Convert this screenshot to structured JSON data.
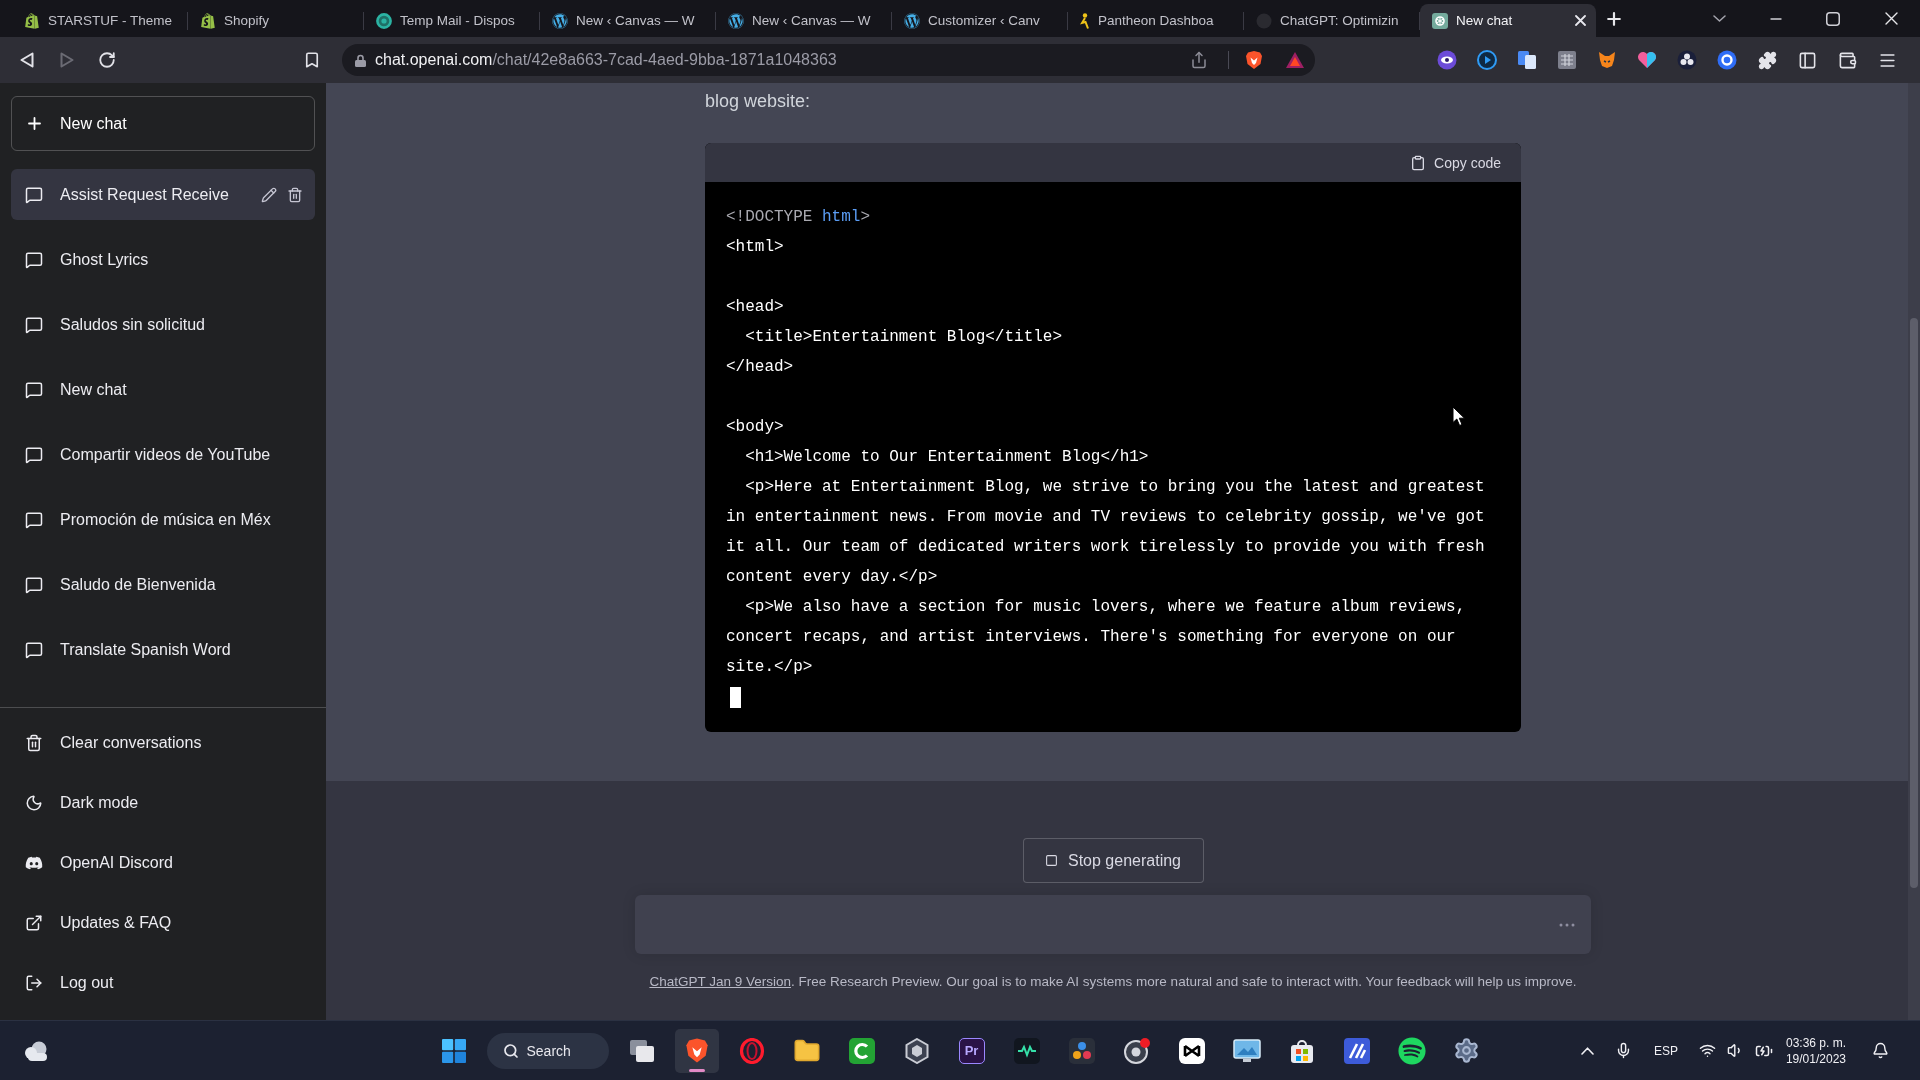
{
  "browser": {
    "tabs": [
      {
        "kind": "bag",
        "title": "STARSTUF - Theme",
        "selected": false
      },
      {
        "kind": "bag",
        "title": "Shopify",
        "selected": false
      },
      {
        "kind": "ring",
        "title": "Temp Mail - Dispos",
        "selected": false
      },
      {
        "kind": "w-circle",
        "title": "New ‹ Canvas — W",
        "selected": false
      },
      {
        "kind": "w-circle",
        "title": "New ‹ Canvas — W",
        "selected": false
      },
      {
        "kind": "w-circle",
        "title": "Customizer ‹ Canv",
        "selected": false
      },
      {
        "kind": "figure",
        "title": "Pantheon Dashboa",
        "selected": false
      },
      {
        "kind": "dark-circle",
        "title": "ChatGPT: Optimizin",
        "selected": false
      },
      {
        "kind": "knot",
        "title": "New chat",
        "selected": true
      }
    ],
    "nav_buttons": [
      {
        "kind": "back",
        "disabled": false
      },
      {
        "kind": "forward",
        "disabled": true
      },
      {
        "kind": "reload",
        "disabled": false
      }
    ],
    "address": {
      "host": "chat.openai.com",
      "path": "/chat/42e8a663-7cad-4aed-9bba-1871a1048363"
    }
  },
  "sidebar": {
    "new_chat": "New chat",
    "chats": [
      {
        "title": "Assist Request Receive",
        "selected": true
      },
      {
        "title": "Ghost Lyrics",
        "selected": false
      },
      {
        "title": "Saludos sin solicitud",
        "selected": false
      },
      {
        "title": "New chat",
        "selected": false
      },
      {
        "title": "Compartir videos de YouTube",
        "selected": false
      },
      {
        "title": "Promoción de música en Méx",
        "selected": false
      },
      {
        "title": "Saludo de Bienvenida",
        "selected": false
      },
      {
        "title": "Translate Spanish Word",
        "selected": false
      }
    ],
    "menu": [
      {
        "kind": "clear",
        "label": "Clear conversations"
      },
      {
        "kind": "theme",
        "label": "Dark mode"
      },
      {
        "kind": "discord",
        "label": "OpenAI Discord"
      },
      {
        "kind": "link",
        "label": "Updates & FAQ"
      },
      {
        "kind": "logout",
        "label": "Log out"
      }
    ]
  },
  "conversation": {
    "message_tail": "blog website:",
    "code_block": {
      "copy_label": "Copy code",
      "streaming": true,
      "lines": [
        {
          "kind": "code",
          "segments": [
            {
              "kind": "meta",
              "text": "<!DOCTYPE "
            },
            {
              "kind": "keyword",
              "text": "html"
            },
            {
              "kind": "meta",
              "text": ">"
            }
          ]
        },
        {
          "kind": "code",
          "segments": [
            {
              "kind": "plain",
              "text": "<html>"
            }
          ]
        },
        {
          "kind": "blank"
        },
        {
          "kind": "code",
          "segments": [
            {
              "kind": "plain",
              "text": "<head>"
            }
          ]
        },
        {
          "kind": "code",
          "segments": [
            {
              "kind": "plain",
              "text": "  <title>Entertainment Blog</title>"
            }
          ]
        },
        {
          "kind": "code",
          "segments": [
            {
              "kind": "plain",
              "text": "</head>"
            }
          ]
        },
        {
          "kind": "blank"
        },
        {
          "kind": "code",
          "segments": [
            {
              "kind": "plain",
              "text": "<body>"
            }
          ]
        },
        {
          "kind": "code",
          "segments": [
            {
              "kind": "plain",
              "text": "  <h1>Welcome to Our Entertainment Blog</h1>"
            }
          ]
        },
        {
          "kind": "code",
          "segments": [
            {
              "kind": "plain",
              "text": "  <p>Here at Entertainment Blog, we strive to bring you the latest and greatest in entertainment news. From movie and TV reviews to celebrity gossip, we've got it all. Our team of dedicated writers work tirelessly to provide you with fresh content every day.</p>"
            }
          ]
        },
        {
          "kind": "code",
          "segments": [
            {
              "kind": "plain",
              "text": "  <p>We also have a section for music lovers, where we feature album reviews, concert recaps, and artist interviews. There's something for everyone on our site.</p>"
            }
          ]
        }
      ]
    }
  },
  "composer": {
    "stop_label": "Stop generating",
    "busy": true
  },
  "footer": {
    "link": "ChatGPT Jan 9 Version",
    "text": ". Free Research Preview. Our goal is to make AI systems more natural and safe to interact with. Your feedback will help us improve."
  },
  "taskbar": {
    "search_label": "Search",
    "apps": [
      {
        "kind": "taskview",
        "active": false
      },
      {
        "kind": "lion",
        "active": true
      },
      {
        "kind": "ring",
        "active": false
      },
      {
        "kind": "folder",
        "active": false
      },
      {
        "kind": "c-tile",
        "active": false
      },
      {
        "kind": "hexagon",
        "active": false
      },
      {
        "kind": "letter-tile",
        "label": "Pr",
        "active": false
      },
      {
        "kind": "wave",
        "active": false
      },
      {
        "kind": "palette",
        "active": false
      },
      {
        "kind": "lens",
        "active": false
      },
      {
        "kind": "clapper",
        "active": false
      },
      {
        "kind": "monitor",
        "active": false
      },
      {
        "kind": "bag-tile",
        "active": false
      },
      {
        "kind": "slash-tile",
        "active": false
      },
      {
        "kind": "disc-waves",
        "active": false
      },
      {
        "kind": "gear",
        "active": false
      }
    ],
    "language": "ESP",
    "time": "03:36 p. m.",
    "date": "19/01/2023"
  }
}
